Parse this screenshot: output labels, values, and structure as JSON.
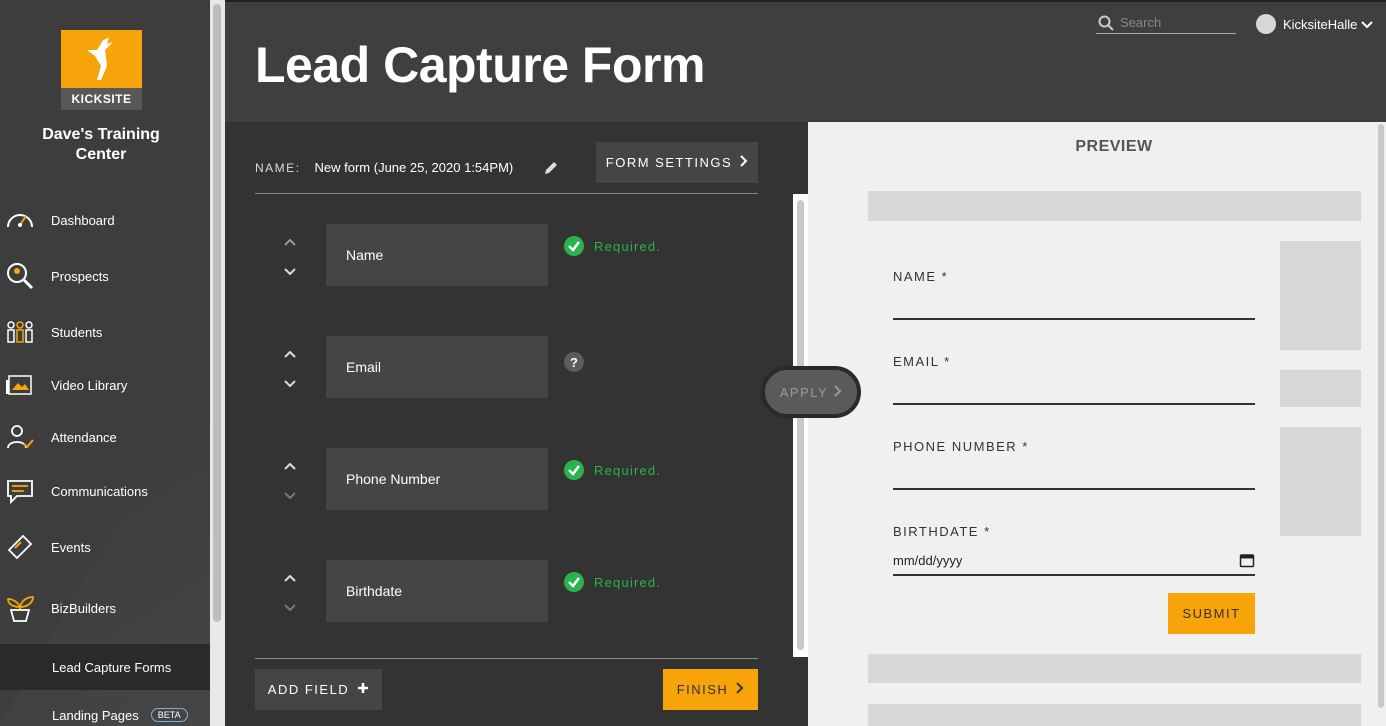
{
  "sidebar": {
    "logo_text": "KICKSITE",
    "school_name_line1": "Dave's Training",
    "school_name_line2": "Center",
    "items": [
      {
        "label": "Dashboard",
        "icon": "gauge-icon"
      },
      {
        "label": "Prospects",
        "icon": "search-person-icon"
      },
      {
        "label": "Students",
        "icon": "students-icon"
      },
      {
        "label": "Video Library",
        "icon": "video-library-icon"
      },
      {
        "label": "Attendance",
        "icon": "attendance-icon"
      },
      {
        "label": "Communications",
        "icon": "chat-icon"
      },
      {
        "label": "Events",
        "icon": "ticket-icon"
      },
      {
        "label": "BizBuilders",
        "icon": "plant-icon"
      }
    ],
    "sub_items": [
      {
        "label": "Lead Capture Forms",
        "active": true
      },
      {
        "label": "Landing Pages",
        "badge": "BETA"
      }
    ]
  },
  "header": {
    "title": "Lead Capture Form",
    "search_placeholder": "Search",
    "user_name": "KicksiteHalle"
  },
  "editor": {
    "name_label": "NAME:",
    "name_value": "New form (June 25, 2020  1:54PM)",
    "form_settings_label": "FORM SETTINGS",
    "fields": [
      {
        "label": "Name",
        "status": "Required."
      },
      {
        "label": "Email",
        "status": ""
      },
      {
        "label": "Phone Number",
        "status": "Required."
      },
      {
        "label": "Birthdate",
        "status": "Required."
      }
    ],
    "add_field_label": "ADD FIELD",
    "finish_label": "FINISH",
    "apply_label": "APPLY"
  },
  "preview": {
    "title": "PREVIEW",
    "fields": [
      {
        "label": "NAME *"
      },
      {
        "label": "EMAIL *"
      },
      {
        "label": "PHONE NUMBER *"
      },
      {
        "label": "BIRTHDATE *",
        "value": "mm/dd/yyyy"
      }
    ],
    "submit_label": "SUBMIT"
  },
  "colors": {
    "accent": "#f7a40a",
    "required_green": "#2ab24e",
    "sidebar_bg": "#3d3d3d"
  }
}
